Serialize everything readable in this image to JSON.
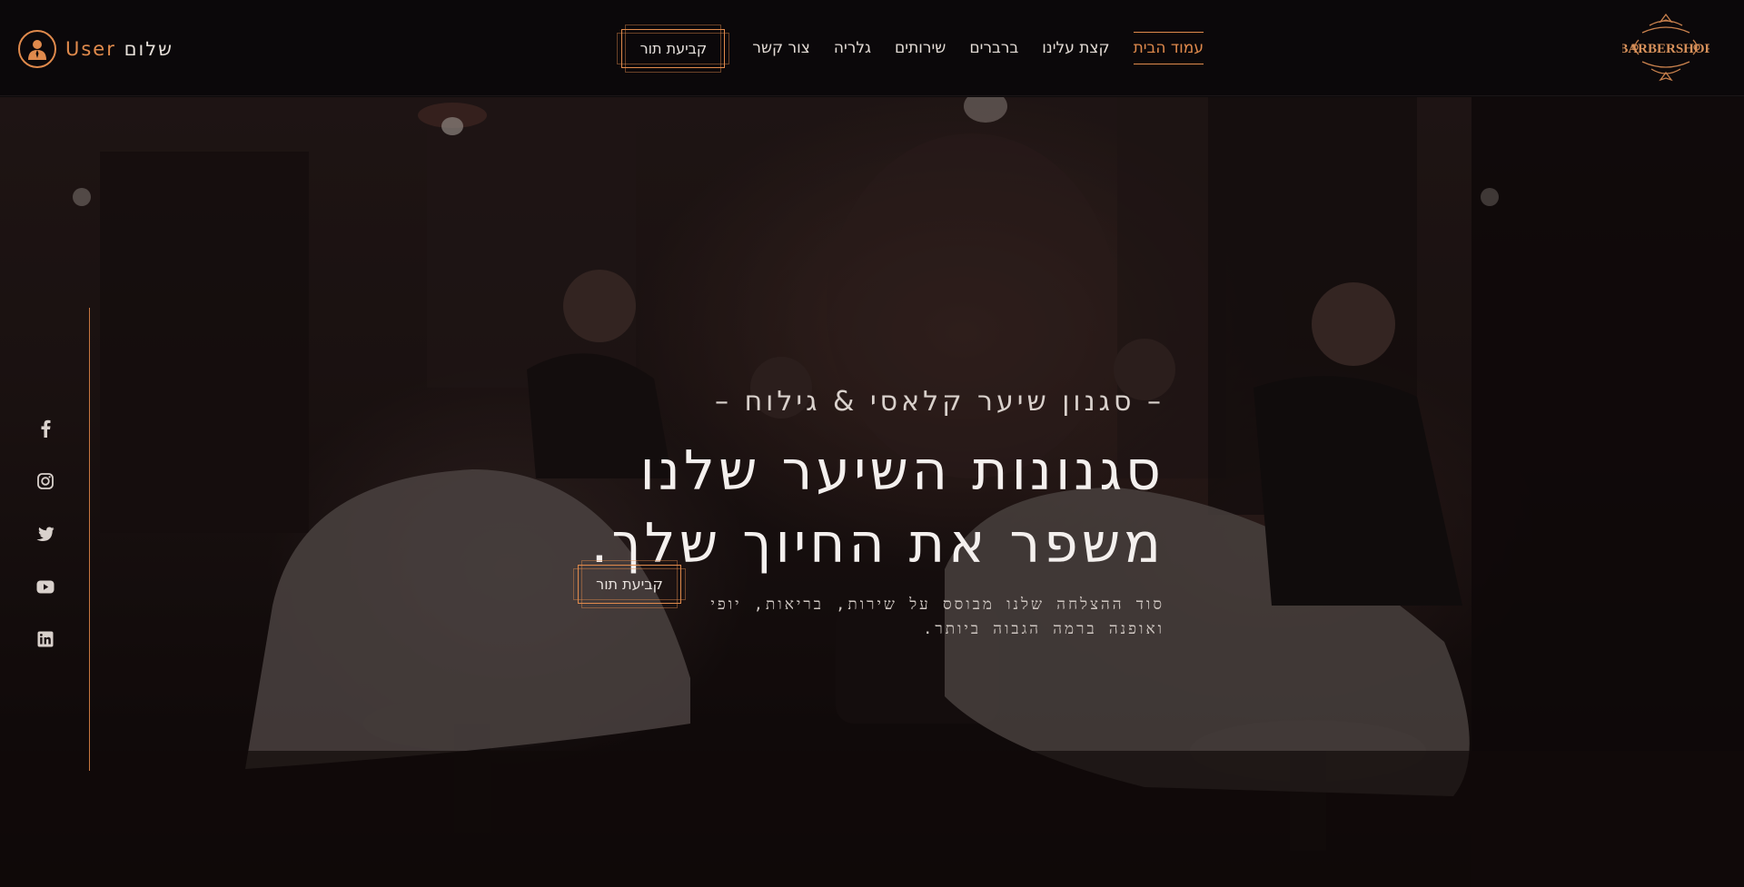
{
  "header": {
    "logo_text": "BARBERSHOP",
    "nav": [
      {
        "label": "עמוד הבית",
        "active": true
      },
      {
        "label": "קצת עלינו",
        "active": false
      },
      {
        "label": "ברברים",
        "active": false
      },
      {
        "label": "שירותים",
        "active": false
      },
      {
        "label": "גלריה",
        "active": false
      },
      {
        "label": "צור קשר",
        "active": false
      }
    ],
    "cta_label": "קביעת תור",
    "user": {
      "greeting": "שלום",
      "name": "User",
      "icon": "user-icon"
    }
  },
  "hero": {
    "subtitle": "– סגנון שיער קלאסי & גילוח –",
    "title_line1": "סגנונות השיער שלנו",
    "title_line2": "משפר את החיוך שלך.",
    "description": "סוד ההצלחה שלנו מבוסס על שירות, בריאות, יופי ואופנה ברמה הגבוה ביותר.",
    "cta_label": "קביעת תור"
  },
  "social": [
    "facebook-icon",
    "instagram-icon",
    "twitter-icon",
    "youtube-icon",
    "linkedin-icon"
  ],
  "colors": {
    "accent": "#e08a4c",
    "background": "#0b080a",
    "text": "#e8e2de"
  }
}
